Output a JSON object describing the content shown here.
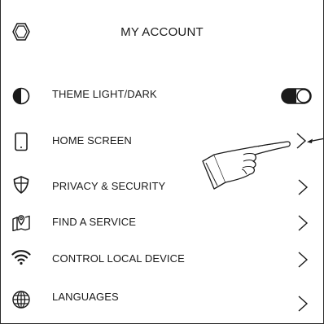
{
  "header": {
    "title": "MY ACCOUNT",
    "logo_icon": "hexagon-logo-icon"
  },
  "menu": {
    "items": [
      {
        "label": "THEME LIGHT/DARK",
        "icon": "contrast-icon",
        "control": "toggle",
        "toggle_on": true
      },
      {
        "label": "HOME SCREEN",
        "icon": "smartphone-icon",
        "control": "chevron"
      },
      {
        "label": "PRIVACY & SECURITY",
        "icon": "shield-icon",
        "control": "chevron"
      },
      {
        "label": "FIND A SERVICE",
        "icon": "map-pin-icon",
        "control": "chevron"
      },
      {
        "label": "CONTROL LOCAL DEVICE",
        "icon": "wifi-icon",
        "control": "chevron"
      },
      {
        "label": "LANGUAGES",
        "icon": "globe-icon",
        "control": "chevron"
      }
    ]
  },
  "annotation": {
    "pointer_icon": "pointing-hand-icon",
    "arrow_icon": "callout-arrow-icon"
  },
  "colors": {
    "stroke": "#1a1a1a",
    "background": "#ffffff"
  }
}
